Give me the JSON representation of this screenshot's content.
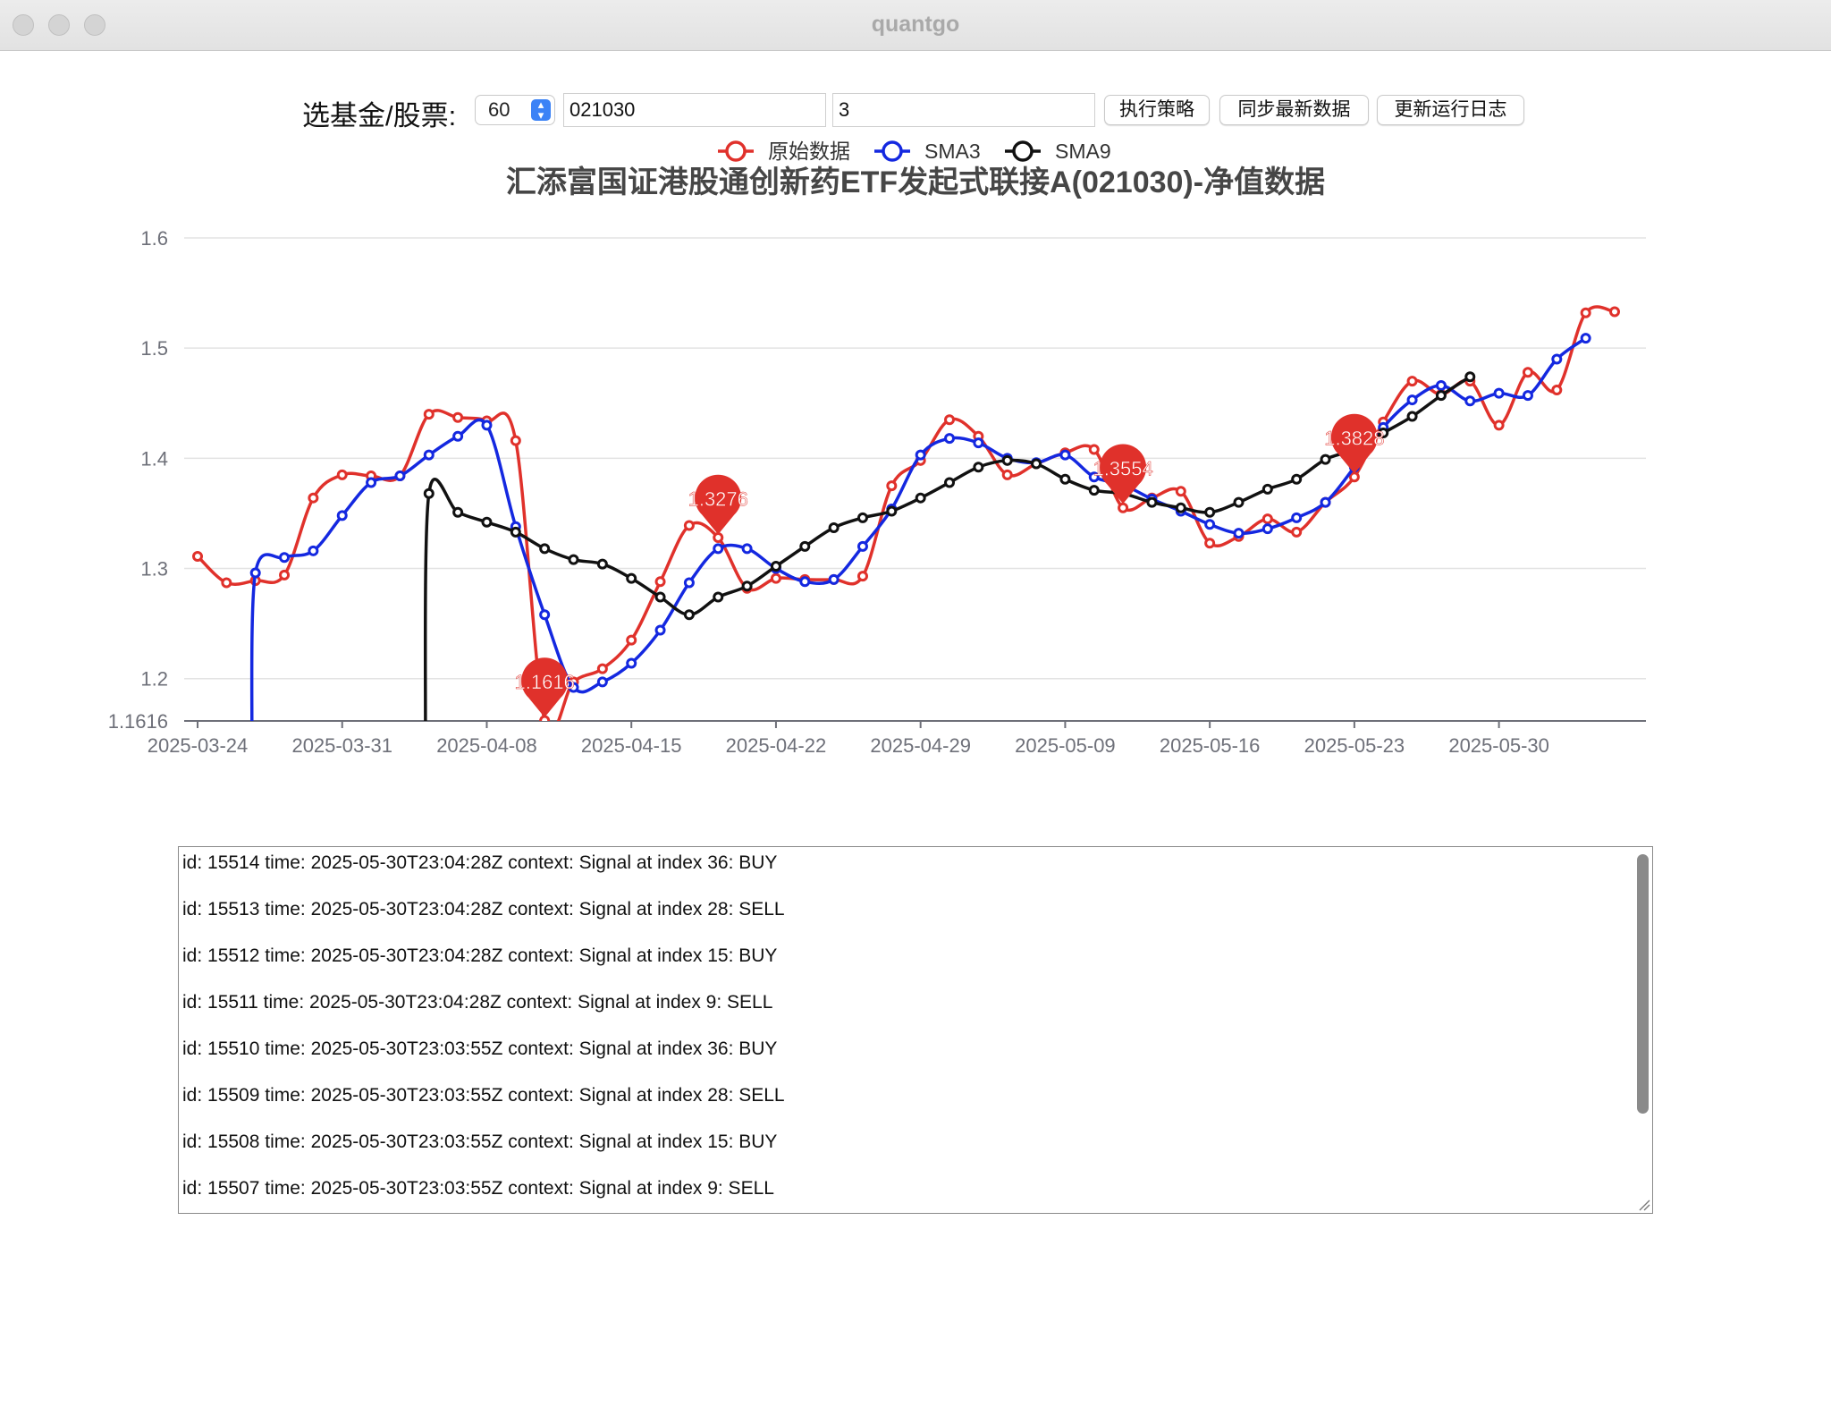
{
  "window": {
    "title": "quantgo"
  },
  "toolbar": {
    "label": "选基金/股票:",
    "period_value": "60",
    "code_value": "021030",
    "param_value": "3",
    "run_label": "执行策略",
    "sync_label": "同步最新数据",
    "update_label": "更新运行日志"
  },
  "chart_data": {
    "type": "line",
    "title": "汇添富国证港股通创新药ETF发起式联接A(021030)-净值数据",
    "legend": [
      "原始数据",
      "SMA3",
      "SMA9"
    ],
    "legend_position": "top-center",
    "grid": true,
    "ylim": [
      1.1616,
      1.6
    ],
    "y_ticks": [
      "1.1616",
      "1.2",
      "1.3",
      "1.4",
      "1.5",
      "1.6"
    ],
    "x_tick_labels": [
      "2025-03-24",
      "2025-03-31",
      "2025-04-08",
      "2025-04-15",
      "2025-04-22",
      "2025-04-29",
      "2025-05-09",
      "2025-05-16",
      "2025-05-23",
      "2025-05-30"
    ],
    "x_tick_index": [
      0,
      5,
      10,
      15,
      20,
      25,
      30,
      35,
      40,
      45
    ],
    "series": [
      {
        "name": "原始数据",
        "color": "#e0312b",
        "values": [
          1.311,
          1.287,
          1.289,
          1.294,
          1.364,
          1.385,
          1.384,
          1.384,
          1.44,
          1.437,
          1.434,
          1.416,
          1.162,
          1.197,
          1.209,
          1.235,
          1.288,
          1.339,
          1.328,
          1.282,
          1.291,
          1.29,
          1.29,
          1.293,
          1.375,
          1.398,
          1.435,
          1.42,
          1.385,
          1.395,
          1.405,
          1.408,
          1.355,
          1.364,
          1.37,
          1.323,
          1.329,
          1.345,
          1.333,
          1.36,
          1.383,
          1.433,
          1.47,
          1.458,
          1.47,
          1.43,
          1.478,
          1.462,
          1.532,
          1.533
        ]
      },
      {
        "name": "SMA3",
        "color": "#1428e0",
        "values": [
          null,
          null,
          1.296,
          1.31,
          1.316,
          1.348,
          1.378,
          1.384,
          1.403,
          1.42,
          1.43,
          1.338,
          1.258,
          1.192,
          1.197,
          1.214,
          1.244,
          1.287,
          1.318,
          1.318,
          1.3,
          1.288,
          1.29,
          1.32,
          1.354,
          1.403,
          1.418,
          1.414,
          1.4,
          1.396,
          1.403,
          1.383,
          1.376,
          1.363,
          1.352,
          1.34,
          1.332,
          1.336,
          1.346,
          1.36,
          1.392,
          1.428,
          1.453,
          1.466,
          1.452,
          1.459,
          1.457,
          1.49,
          1.509
        ]
      },
      {
        "name": "SMA9",
        "color": "#111111",
        "values": [
          null,
          null,
          null,
          null,
          null,
          null,
          null,
          null,
          1.368,
          1.351,
          1.342,
          1.333,
          1.318,
          1.308,
          1.304,
          1.291,
          1.274,
          1.258,
          1.274,
          1.284,
          1.302,
          1.32,
          1.337,
          1.346,
          1.352,
          1.364,
          1.378,
          1.392,
          1.398,
          1.395,
          1.381,
          1.371,
          1.368,
          1.36,
          1.355,
          1.351,
          1.36,
          1.372,
          1.381,
          1.399,
          1.408,
          1.423,
          1.438,
          1.457,
          1.474
        ]
      }
    ],
    "markers": [
      {
        "label": "1.1616",
        "index": 12,
        "value": 1.1616
      },
      {
        "label": "1.3276",
        "index": 18,
        "value": 1.3276
      },
      {
        "label": "1.3554",
        "index": 32,
        "value": 1.3554
      },
      {
        "label": "1.3828",
        "index": 40,
        "value": 1.3828
      }
    ]
  },
  "log": {
    "lines": [
      "id: 15514 time: 2025-05-30T23:04:28Z context: Signal at index 36: BUY",
      "id: 15513 time: 2025-05-30T23:04:28Z context: Signal at index 28: SELL",
      "id: 15512 time: 2025-05-30T23:04:28Z context: Signal at index 15: BUY",
      "id: 15511 time: 2025-05-30T23:04:28Z context: Signal at index 9: SELL",
      "id: 15510 time: 2025-05-30T23:03:55Z context: Signal at index 36: BUY",
      "id: 15509 time: 2025-05-30T23:03:55Z context: Signal at index 28: SELL",
      "id: 15508 time: 2025-05-30T23:03:55Z context: Signal at index 15: BUY",
      "id: 15507 time: 2025-05-30T23:03:55Z context: Signal at index 9: SELL"
    ]
  }
}
